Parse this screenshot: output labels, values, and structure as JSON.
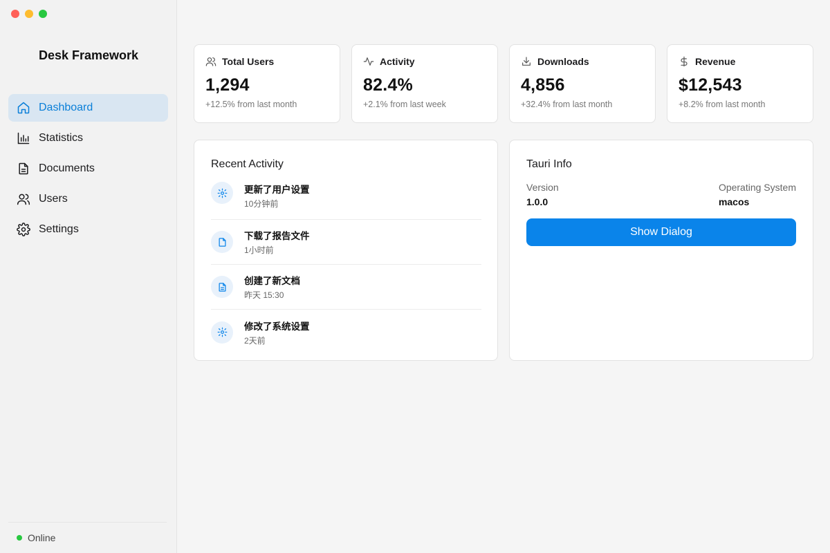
{
  "window": {
    "controls": [
      "close",
      "minimize",
      "zoom"
    ]
  },
  "sidebar": {
    "app_title": "Desk Framework",
    "items": [
      {
        "label": "Dashboard",
        "icon": "home-icon",
        "active": true
      },
      {
        "label": "Statistics",
        "icon": "bar-chart-icon",
        "active": false
      },
      {
        "label": "Documents",
        "icon": "document-icon",
        "active": false
      },
      {
        "label": "Users",
        "icon": "users-icon",
        "active": false
      },
      {
        "label": "Settings",
        "icon": "gear-icon",
        "active": false
      }
    ],
    "status": "Online"
  },
  "stats": [
    {
      "title": "Total Users",
      "icon": "users-icon",
      "value": "1,294",
      "change": "+12.5% from last month"
    },
    {
      "title": "Activity",
      "icon": "activity-icon",
      "value": "82.4%",
      "change": "+2.1% from last week"
    },
    {
      "title": "Downloads",
      "icon": "download-icon",
      "value": "4,856",
      "change": "+32.4% from last month"
    },
    {
      "title": "Revenue",
      "icon": "dollar-icon",
      "value": "$12,543",
      "change": "+8.2% from last month"
    }
  ],
  "recent_activity": {
    "title": "Recent Activity",
    "items": [
      {
        "title": "更新了用户设置",
        "time": "10分钟前",
        "icon": "gear-icon"
      },
      {
        "title": "下载了报告文件",
        "time": "1小时前",
        "icon": "file-icon"
      },
      {
        "title": "创建了新文档",
        "time": "昨天 15:30",
        "icon": "document-icon"
      },
      {
        "title": "修改了系统设置",
        "time": "2天前",
        "icon": "gear-icon"
      }
    ]
  },
  "tauri_info": {
    "title": "Tauri Info",
    "version_label": "Version",
    "version_value": "1.0.0",
    "os_label": "Operating System",
    "os_value": "macos",
    "button_label": "Show Dialog"
  },
  "colors": {
    "accent": "#0a84ea",
    "active_bg": "#d9e6f2",
    "online": "#28c840"
  }
}
